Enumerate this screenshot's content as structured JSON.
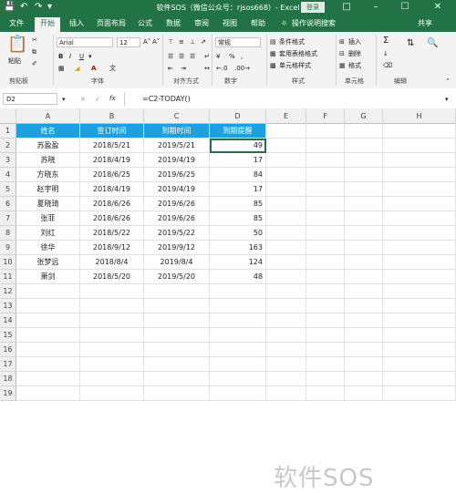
{
  "window": {
    "title": "软件SOS（微信公众号：rjsos668）- Excel",
    "login": "登录"
  },
  "tabs": [
    "文件",
    "开始",
    "插入",
    "页面布局",
    "公式",
    "数据",
    "审阅",
    "视图",
    "帮助"
  ],
  "tell_me": "操作说明搜索",
  "share": "共享",
  "ribbon": {
    "paste": "粘贴",
    "font_name": "Arial",
    "font_size": "12",
    "bold": "B",
    "italic": "I",
    "underline": "U",
    "number_format": "常规",
    "cond_format": "条件格式",
    "table_format": "套用表格格式",
    "cell_style": "单元格样式",
    "insert": "插入",
    "delete": "删除",
    "format": "格式",
    "groups": [
      "剪贴板",
      "字体",
      "对齐方式",
      "数字",
      "样式",
      "单元格",
      "编辑"
    ]
  },
  "formula_bar": {
    "name_box": "D2",
    "fx": "fx",
    "formula": "=C2-TODAY()"
  },
  "columns": [
    "A",
    "B",
    "C",
    "D",
    "E",
    "F",
    "G",
    "H"
  ],
  "rows": [
    "1",
    "2",
    "3",
    "4",
    "5",
    "6",
    "7",
    "8",
    "9",
    "10",
    "11",
    "12",
    "13",
    "14",
    "15",
    "16",
    "17",
    "18",
    "19"
  ],
  "table": {
    "headers": [
      "姓名",
      "签订时间",
      "到期时间",
      "到期提醒"
    ],
    "data": [
      [
        "苏盈盈",
        "2018/5/21",
        "2019/5/21",
        "49"
      ],
      [
        "苏晓",
        "2018/4/19",
        "2019/4/19",
        "17"
      ],
      [
        "方晓东",
        "2018/6/25",
        "2019/6/25",
        "84"
      ],
      [
        "赵宇明",
        "2018/4/19",
        "2019/4/19",
        "17"
      ],
      [
        "夏晓琦",
        "2018/6/26",
        "2019/6/26",
        "85"
      ],
      [
        "张菲",
        "2018/6/26",
        "2019/6/26",
        "85"
      ],
      [
        "刘红",
        "2018/5/22",
        "2019/5/22",
        "50"
      ],
      [
        "徐华",
        "2018/9/12",
        "2019/9/12",
        "163"
      ],
      [
        "张梦远",
        "2018/8/4",
        "2019/8/4",
        "124"
      ],
      [
        "萧剑",
        "2018/5/20",
        "2019/5/20",
        "48"
      ]
    ]
  },
  "watermark": "软件SOS",
  "colors": {
    "excel_green": "#217346",
    "header_fill": "#1ba1e2"
  }
}
